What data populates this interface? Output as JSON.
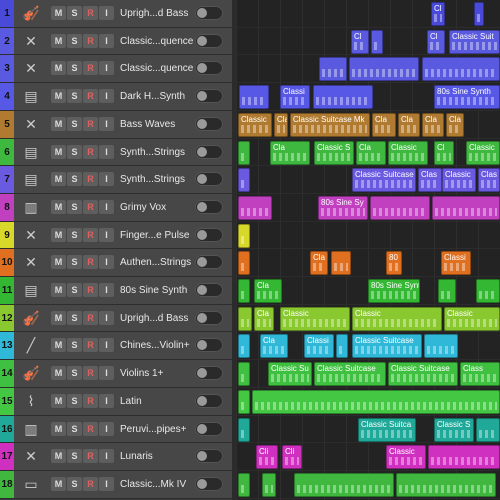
{
  "buttons": {
    "mute": "M",
    "solo": "S",
    "record": "R",
    "input": "I"
  },
  "tracks": [
    {
      "number": "1",
      "name": "Uprigh...d Bass",
      "color": "#4a4ad8",
      "icon": "double-bass-icon",
      "glyph": "🎻"
    },
    {
      "number": "2",
      "name": "Classic...quence",
      "color": "#5a5ae0",
      "icon": "keyboard-stand-icon",
      "glyph": "✕"
    },
    {
      "number": "3",
      "name": "Classic...quence",
      "color": "#5a5ae0",
      "icon": "keyboard-stand-icon",
      "glyph": "✕"
    },
    {
      "number": "4",
      "name": "Dark H...Synth",
      "color": "#5858e6",
      "icon": "synth-keyboard-icon",
      "glyph": "▤"
    },
    {
      "number": "5",
      "name": "Bass Waves",
      "color": "#b07a30",
      "icon": "keyboard-stand-icon",
      "glyph": "✕"
    },
    {
      "number": "6",
      "name": "Synth...Strings",
      "color": "#3fb83f",
      "icon": "synth-keyboard-icon",
      "glyph": "▤"
    },
    {
      "number": "7",
      "name": "Synth...Strings",
      "color": "#6a5ae0",
      "icon": "synth-keyboard-icon",
      "glyph": "▤"
    },
    {
      "number": "8",
      "name": "Grimy Vox",
      "color": "#c040c0",
      "icon": "audio-waveform-icon",
      "glyph": "▥"
    },
    {
      "number": "9",
      "name": "Finger...e Pulse",
      "color": "#d8d82a",
      "icon": "keyboard-stand-icon",
      "glyph": "✕"
    },
    {
      "number": "10",
      "name": "Authen...Strings",
      "color": "#e07020",
      "icon": "keyboard-stand-icon",
      "glyph": "✕"
    },
    {
      "number": "11",
      "name": "80s Sine Synth",
      "color": "#34b834",
      "icon": "synth-keyboard-icon",
      "glyph": "▤"
    },
    {
      "number": "12",
      "name": "Uprigh...d Bass",
      "color": "#8ac830",
      "icon": "double-bass-icon",
      "glyph": "🎻"
    },
    {
      "number": "13",
      "name": "Chines...Violin+",
      "color": "#30b8d8",
      "icon": "erhu-icon",
      "glyph": "╱"
    },
    {
      "number": "14",
      "name": "Violins 1+",
      "color": "#40c040",
      "icon": "violin-icon",
      "glyph": "🎻"
    },
    {
      "number": "15",
      "name": "Latin",
      "color": "#44c844",
      "icon": "latin-percussion-icon",
      "glyph": "⌇"
    },
    {
      "number": "16",
      "name": "Peruvi...pipes+",
      "color": "#20a898",
      "icon": "panpipes-icon",
      "glyph": "▥"
    },
    {
      "number": "17",
      "name": "Lunaris",
      "color": "#d030c0",
      "icon": "keyboard-stand-icon",
      "glyph": "✕"
    },
    {
      "number": "18",
      "name": "Classic...Mk IV",
      "color": "#40b840",
      "icon": "electric-piano-icon",
      "glyph": "▭"
    }
  ],
  "regions": [
    {
      "track": 1,
      "label": "Cl",
      "color": "#4a4ad8",
      "start": 195,
      "width": 14
    },
    {
      "track": 1,
      "label": "",
      "color": "#4a4ad8",
      "start": 238,
      "width": 10
    },
    {
      "track": 2,
      "label": "Cl",
      "color": "#5a5ae0",
      "start": 115,
      "width": 18
    },
    {
      "track": 2,
      "label": "",
      "color": "#5a5ae0",
      "start": 135,
      "width": 12
    },
    {
      "track": 2,
      "label": "Cl",
      "color": "#5a5ae0",
      "start": 191,
      "width": 18
    },
    {
      "track": 2,
      "label": "Classic Suit",
      "color": "#5a5ae0",
      "start": 213,
      "width": 51
    },
    {
      "track": 3,
      "label": "",
      "color": "#5a5ae0",
      "start": 83,
      "width": 28
    },
    {
      "track": 3,
      "label": "",
      "color": "#5a5ae0",
      "start": 113,
      "width": 70
    },
    {
      "track": 3,
      "label": "",
      "color": "#5a5ae0",
      "start": 186,
      "width": 78
    },
    {
      "track": 4,
      "label": "",
      "color": "#5858e6",
      "start": 3,
      "width": 30
    },
    {
      "track": 4,
      "label": "Classi",
      "color": "#5858e6",
      "start": 44,
      "width": 30
    },
    {
      "track": 4,
      "label": "",
      "color": "#5858e6",
      "start": 77,
      "width": 60
    },
    {
      "track": 4,
      "label": "80s Sine Synth",
      "color": "#5858e6",
      "start": 198,
      "width": 66
    },
    {
      "track": 5,
      "label": "Classic",
      "color": "#b07a30",
      "start": 2,
      "width": 34
    },
    {
      "track": 5,
      "label": "Cla",
      "color": "#b07a30",
      "start": 38,
      "width": 14
    },
    {
      "track": 5,
      "label": "Classic Suitcase Mk",
      "color": "#b07a30",
      "start": 54,
      "width": 80
    },
    {
      "track": 5,
      "label": "Cla",
      "color": "#b07a30",
      "start": 136,
      "width": 24
    },
    {
      "track": 5,
      "label": "Cla",
      "color": "#b07a30",
      "start": 162,
      "width": 22
    },
    {
      "track": 5,
      "label": "Cla",
      "color": "#b07a30",
      "start": 186,
      "width": 22
    },
    {
      "track": 5,
      "label": "Cla",
      "color": "#b07a30",
      "start": 210,
      "width": 18
    },
    {
      "track": 6,
      "label": "",
      "color": "#3fb83f",
      "start": 2,
      "width": 12
    },
    {
      "track": 6,
      "label": "Cla",
      "color": "#3fb83f",
      "start": 34,
      "width": 40
    },
    {
      "track": 6,
      "label": "Classic S",
      "color": "#3fb83f",
      "start": 78,
      "width": 40
    },
    {
      "track": 6,
      "label": "Cla",
      "color": "#3fb83f",
      "start": 120,
      "width": 30
    },
    {
      "track": 6,
      "label": "Classic",
      "color": "#3fb83f",
      "start": 152,
      "width": 40
    },
    {
      "track": 6,
      "label": "Cl",
      "color": "#3fb83f",
      "start": 198,
      "width": 20
    },
    {
      "track": 6,
      "label": "Classic",
      "color": "#3fb83f",
      "start": 230,
      "width": 34
    },
    {
      "track": 7,
      "label": "",
      "color": "#6a5ae0",
      "start": 2,
      "width": 12
    },
    {
      "track": 7,
      "label": "Classic Suitcase",
      "color": "#6a5ae0",
      "start": 116,
      "width": 64
    },
    {
      "track": 7,
      "label": "Clas",
      "color": "#6a5ae0",
      "start": 182,
      "width": 24
    },
    {
      "track": 7,
      "label": "Classic",
      "color": "#6a5ae0",
      "start": 206,
      "width": 34
    },
    {
      "track": 7,
      "label": "Clas",
      "color": "#6a5ae0",
      "start": 242,
      "width": 22
    },
    {
      "track": 8,
      "label": "",
      "color": "#c040c0",
      "start": 2,
      "width": 34
    },
    {
      "track": 8,
      "label": "80s Sine Sy",
      "color": "#c040c0",
      "start": 82,
      "width": 50
    },
    {
      "track": 8,
      "label": "",
      "color": "#c040c0",
      "start": 134,
      "width": 60
    },
    {
      "track": 8,
      "label": "",
      "color": "#c040c0",
      "start": 196,
      "width": 68
    },
    {
      "track": 9,
      "label": "",
      "color": "#d8d82a",
      "start": 2,
      "width": 12
    },
    {
      "track": 10,
      "label": "",
      "color": "#e07020",
      "start": 2,
      "width": 12
    },
    {
      "track": 10,
      "label": "Cla",
      "color": "#e07020",
      "start": 74,
      "width": 18
    },
    {
      "track": 10,
      "label": "",
      "color": "#e07020",
      "start": 95,
      "width": 20
    },
    {
      "track": 10,
      "label": "80",
      "color": "#e07020",
      "start": 150,
      "width": 16
    },
    {
      "track": 10,
      "label": "Classi",
      "color": "#e07020",
      "start": 205,
      "width": 30
    },
    {
      "track": 11,
      "label": "",
      "color": "#34b834",
      "start": 2,
      "width": 12
    },
    {
      "track": 11,
      "label": "Cla",
      "color": "#34b834",
      "start": 18,
      "width": 28
    },
    {
      "track": 11,
      "label": "80s Sine Synth",
      "color": "#34b834",
      "start": 132,
      "width": 52
    },
    {
      "track": 11,
      "label": "",
      "color": "#34b834",
      "start": 202,
      "width": 18
    },
    {
      "track": 11,
      "label": "",
      "color": "#34b834",
      "start": 240,
      "width": 24
    },
    {
      "track": 12,
      "label": "",
      "color": "#8ac830",
      "start": 2,
      "width": 14
    },
    {
      "track": 12,
      "label": "Cla",
      "color": "#8ac830",
      "start": 18,
      "width": 20
    },
    {
      "track": 12,
      "label": "Classic",
      "color": "#8ac830",
      "start": 44,
      "width": 70
    },
    {
      "track": 12,
      "label": "Classic",
      "color": "#8ac830",
      "start": 116,
      "width": 90
    },
    {
      "track": 12,
      "label": "Classic",
      "color": "#8ac830",
      "start": 208,
      "width": 56
    },
    {
      "track": 13,
      "label": "",
      "color": "#30b8d8",
      "start": 2,
      "width": 12
    },
    {
      "track": 13,
      "label": "Cla",
      "color": "#30b8d8",
      "start": 24,
      "width": 28
    },
    {
      "track": 13,
      "label": "Classi",
      "color": "#30b8d8",
      "start": 68,
      "width": 30
    },
    {
      "track": 13,
      "label": "",
      "color": "#30b8d8",
      "start": 100,
      "width": 12
    },
    {
      "track": 13,
      "label": "Classic Suitcase",
      "color": "#30b8d8",
      "start": 116,
      "width": 70
    },
    {
      "track": 13,
      "label": "",
      "color": "#30b8d8",
      "start": 188,
      "width": 34
    },
    {
      "track": 14,
      "label": "",
      "color": "#40c040",
      "start": 2,
      "width": 12
    },
    {
      "track": 14,
      "label": "Classic Su",
      "color": "#40c040",
      "start": 32,
      "width": 44
    },
    {
      "track": 14,
      "label": "Classic Suitcase",
      "color": "#40c040",
      "start": 78,
      "width": 72
    },
    {
      "track": 14,
      "label": "Classic Suitcase",
      "color": "#40c040",
      "start": 152,
      "width": 70
    },
    {
      "track": 14,
      "label": "Class",
      "color": "#40c040",
      "start": 224,
      "width": 40
    },
    {
      "track": 15,
      "label": "",
      "color": "#44c844",
      "start": 2,
      "width": 12
    },
    {
      "track": 15,
      "label": "",
      "color": "#44c844",
      "start": 16,
      "width": 248
    },
    {
      "track": 16,
      "label": "",
      "color": "#20a898",
      "start": 2,
      "width": 12
    },
    {
      "track": 16,
      "label": "Classic Suitca",
      "color": "#20a898",
      "start": 122,
      "width": 58
    },
    {
      "track": 16,
      "label": "Classic S",
      "color": "#20a898",
      "start": 198,
      "width": 40
    },
    {
      "track": 16,
      "label": "",
      "color": "#20a898",
      "start": 240,
      "width": 24
    },
    {
      "track": 17,
      "label": "Cli",
      "color": "#d030c0",
      "start": 20,
      "width": 22
    },
    {
      "track": 17,
      "label": "Cli",
      "color": "#d030c0",
      "start": 46,
      "width": 20
    },
    {
      "track": 17,
      "label": "Classic",
      "color": "#d030c0",
      "start": 150,
      "width": 40
    },
    {
      "track": 17,
      "label": "",
      "color": "#d030c0",
      "start": 192,
      "width": 72
    },
    {
      "track": 18,
      "label": "",
      "color": "#40b840",
      "start": 2,
      "width": 12
    },
    {
      "track": 18,
      "label": "",
      "color": "#40b840",
      "start": 26,
      "width": 14
    },
    {
      "track": 18,
      "label": "",
      "color": "#40b840",
      "start": 58,
      "width": 100
    },
    {
      "track": 18,
      "label": "",
      "color": "#40b840",
      "start": 160,
      "width": 100
    }
  ]
}
